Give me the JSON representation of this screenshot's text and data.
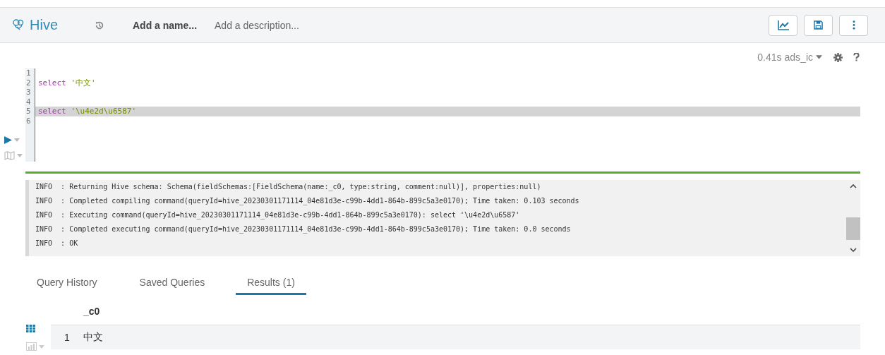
{
  "header": {
    "app_name": "Hive",
    "name_placeholder": "Add a name...",
    "description_placeholder": "Add a description..."
  },
  "status": {
    "time": "0.41s",
    "database": "ads_ic"
  },
  "editor": {
    "lines": [
      {
        "number": "1",
        "highlighted": false
      },
      {
        "number": "2",
        "tokens": [
          {
            "kind": "keyword",
            "text": "select"
          },
          {
            "kind": "string",
            "text": "'中文'"
          }
        ],
        "highlighted": false
      },
      {
        "number": "3",
        "highlighted": false
      },
      {
        "number": "4",
        "highlighted": false
      },
      {
        "number": "5",
        "tokens": [
          {
            "kind": "keyword",
            "text": "select"
          },
          {
            "kind": "string",
            "text": "'\\u4e2d\\u6587'"
          }
        ],
        "highlighted": true
      },
      {
        "number": "6",
        "highlighted": false
      }
    ]
  },
  "log": [
    "INFO  : Returning Hive schema: Schema(fieldSchemas:[FieldSchema(name:_c0, type:string, comment:null)], properties:null)",
    "INFO  : Completed compiling command(queryId=hive_20230301171114_04e81d3e-c99b-4dd1-864b-899c5a3e0170); Time taken: 0.103 seconds",
    "INFO  : Executing command(queryId=hive_20230301171114_04e81d3e-c99b-4dd1-864b-899c5a3e0170): select '\\u4e2d\\u6587'",
    "INFO  : Completed executing command(queryId=hive_20230301171114_04e81d3e-c99b-4dd1-864b-899c5a3e0170); Time taken: 0.0 seconds",
    "INFO  : OK"
  ],
  "tabs": [
    {
      "label": "Query History",
      "selected": false
    },
    {
      "label": "Saved Queries",
      "selected": false
    },
    {
      "label": "Results (1)",
      "selected": true
    }
  ],
  "results": {
    "columns": [
      "_c0"
    ],
    "rows": [
      {
        "number": "1",
        "cells": [
          "中文"
        ]
      }
    ]
  }
}
